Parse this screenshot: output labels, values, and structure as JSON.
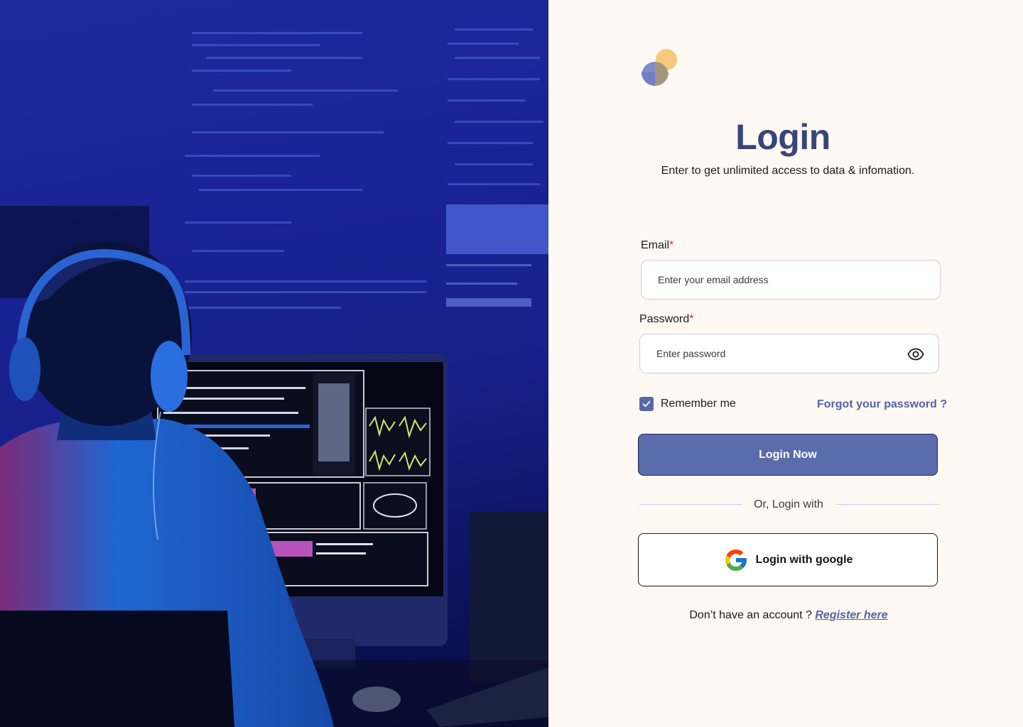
{
  "hero": {
    "image_description_icon": "developer-at-computer-illustration"
  },
  "brand": {
    "logo_icon": "circles-logo-icon",
    "colors": {
      "primary": "#5b6cad",
      "title": "#36457a",
      "accent_yellow": "#f7c97d",
      "accent_blue": "#7f8ccb",
      "accent_brown": "#a69481"
    }
  },
  "login": {
    "title": "Login",
    "subtitle": "Enter to get unlimited access to data & infomation.",
    "email": {
      "label": "Email",
      "required_mark": "*",
      "placeholder": "Enter your email address"
    },
    "password": {
      "label": "Password",
      "required_mark": "*",
      "placeholder": "Enter password",
      "toggle_icon": "eye-icon"
    },
    "remember_me": {
      "label": "Remember me",
      "checked": true
    },
    "forgot_password": "Forgot your password ?",
    "submit_label": "Login Now",
    "divider_text": "Or, Login with",
    "google": {
      "label": "Login with google",
      "icon": "google-icon"
    },
    "register": {
      "prompt": "Don’t have an account ?",
      "link": "Register here"
    }
  }
}
